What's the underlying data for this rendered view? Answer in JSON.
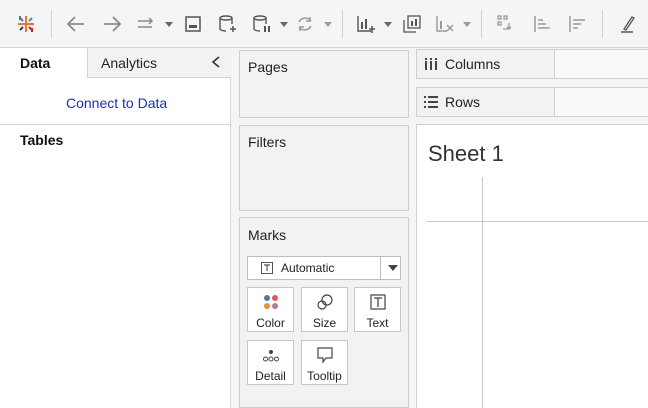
{
  "toolbar": {
    "icons": [
      "tableau-logo-icon",
      "undo-icon",
      "redo-icon",
      "replay-icon",
      "save-icon",
      "new-data-source-icon",
      "pause-updates-icon",
      "refresh-icon",
      "new-worksheet-icon",
      "duplicate-icon",
      "clear-sheet-icon",
      "swap-icon",
      "sort-ascending-icon",
      "sort-descending-icon",
      "highlight-icon"
    ],
    "accent": "#e8762b"
  },
  "left_pane": {
    "tabs": {
      "data": "Data",
      "analytics": "Analytics"
    },
    "connect_link": "Connect to Data",
    "tables_heading": "Tables"
  },
  "cards": {
    "pages": "Pages",
    "filters": "Filters",
    "marks": {
      "title": "Marks",
      "type_value": "Automatic",
      "buttons": [
        {
          "label": "Color",
          "icon": "color-dots-icon"
        },
        {
          "label": "Size",
          "icon": "size-circles-icon"
        },
        {
          "label": "Text",
          "icon": "text-label-icon"
        },
        {
          "label": "Detail",
          "icon": "detail-dots-icon"
        },
        {
          "label": "Tooltip",
          "icon": "tooltip-icon"
        }
      ]
    }
  },
  "shelves": {
    "columns": "Columns",
    "rows": "Rows"
  },
  "sheet": {
    "title": "Sheet 1"
  }
}
